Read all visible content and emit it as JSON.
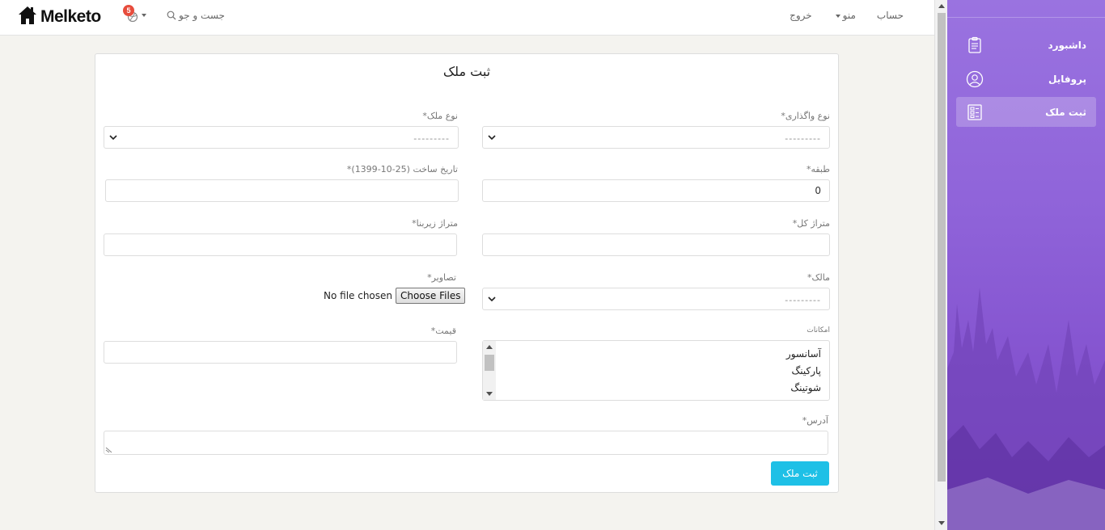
{
  "navbar": {
    "brand": "Melketo",
    "notification_count": "5",
    "search_label": "جست و جو",
    "logout_label": "خروج",
    "menu_label": "منو",
    "account_label": "حساب"
  },
  "sidebar": {
    "items": [
      {
        "label": "داشبورد",
        "icon": "clipboard-icon"
      },
      {
        "label": "پروفایل",
        "icon": "user-circle-icon"
      },
      {
        "label": "ثبت ملک",
        "icon": "list-document-icon",
        "active": true
      }
    ],
    "accent_color": "#8f63d9"
  },
  "form": {
    "title": "ثبت ملک",
    "transfer_type": {
      "label": "نوع واگذاری*",
      "placeholder": "---------"
    },
    "property_type": {
      "label": "نوع ملک*",
      "placeholder": "---------"
    },
    "floor": {
      "label": "طبقه*",
      "value": "0"
    },
    "build_date": {
      "label": "تاریخ ساخت (25-10-1399)*",
      "value": ""
    },
    "total_area": {
      "label": "متراژ کل*",
      "value": ""
    },
    "built_area": {
      "label": "متراژ زیربنا*",
      "value": ""
    },
    "owner": {
      "label": "مالک*",
      "placeholder": "---------"
    },
    "images": {
      "label": "تصاویر*",
      "button": "Choose Files",
      "status": "No file chosen"
    },
    "amenities": {
      "label": "امکانات",
      "options": [
        "آسانسور",
        "پارکینگ",
        "شوتینگ"
      ]
    },
    "price": {
      "label": "قیمت*",
      "value": ""
    },
    "address": {
      "label": "آدرس*",
      "value": ""
    },
    "submit_label": "ثبت ملک",
    "submit_color": "#1ec0e6"
  }
}
